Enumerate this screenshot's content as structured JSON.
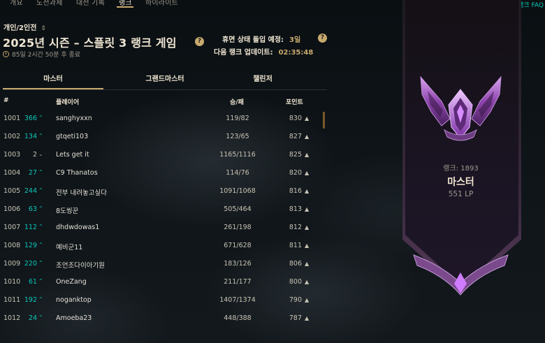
{
  "nav": {
    "tabs": [
      "개요",
      "도전과제",
      "대전 기록",
      "랭크",
      "하이라이트"
    ],
    "active_index": 3
  },
  "faq_link": "랭크 FAQ",
  "queue": {
    "label": "개인/2인전"
  },
  "season": {
    "title": "2025년 시즌 – 스플릿 3 랭크 게임",
    "end_text": "85일 2시간 50분 후 종료"
  },
  "decay": {
    "label": "휴면 상태 돌입 예정:",
    "value": "3일"
  },
  "update": {
    "label": "다음 랭크 업데이트:",
    "value": "02:35:48"
  },
  "tier_tabs": [
    "마스터",
    "그랜드마스터",
    "챌린저"
  ],
  "table": {
    "headers": {
      "rank": "#",
      "player": "플레이어",
      "wl": "승/패",
      "points": "포인트"
    },
    "rows": [
      {
        "rank": "1001",
        "change": "366",
        "dir": "up",
        "player": "sanghyxxn",
        "wl": "119/82",
        "points": "830"
      },
      {
        "rank": "1002",
        "change": "134",
        "dir": "up",
        "player": "gtqeti103",
        "wl": "123/65",
        "points": "827"
      },
      {
        "rank": "1003",
        "change": "2",
        "dir": "down",
        "player": "Lets get it",
        "wl": "1165/1116",
        "points": "825"
      },
      {
        "rank": "1004",
        "change": "27",
        "dir": "up",
        "player": "C9 Thanatos",
        "wl": "114/76",
        "points": "820"
      },
      {
        "rank": "1005",
        "change": "244",
        "dir": "up",
        "player": "전부 내려놓고싶다",
        "wl": "1091/1068",
        "points": "816"
      },
      {
        "rank": "1006",
        "change": "63",
        "dir": "up",
        "player": "8도씽꾼",
        "wl": "505/464",
        "points": "813"
      },
      {
        "rank": "1007",
        "change": "112",
        "dir": "up",
        "player": "dhdwdowas1",
        "wl": "261/198",
        "points": "812"
      },
      {
        "rank": "1008",
        "change": "129",
        "dir": "up",
        "player": "예비군11",
        "wl": "671/628",
        "points": "811"
      },
      {
        "rank": "1009",
        "change": "220",
        "dir": "up",
        "player": "조언조다이아기원",
        "wl": "183/126",
        "points": "806"
      },
      {
        "rank": "1010",
        "change": "61",
        "dir": "up",
        "player": "OneZang",
        "wl": "211/177",
        "points": "800"
      },
      {
        "rank": "1011",
        "change": "192",
        "dir": "up",
        "player": "noganktop",
        "wl": "1407/1374",
        "points": "790"
      },
      {
        "rank": "1012",
        "change": "24",
        "dir": "up",
        "player": "Amoeba23",
        "wl": "448/388",
        "points": "787"
      }
    ]
  },
  "banner": {
    "rank_label": "랭크: 1893",
    "tier": "마스터",
    "lp": "551 LP",
    "emblem_icon": "master-emblem-icon"
  },
  "colors": {
    "gold": "#c8aa6e",
    "teal": "#0ac8b9",
    "text_light": "#f0e6d2",
    "text_muted": "#a09a8c",
    "emblem_purple": "#9b59c6"
  }
}
